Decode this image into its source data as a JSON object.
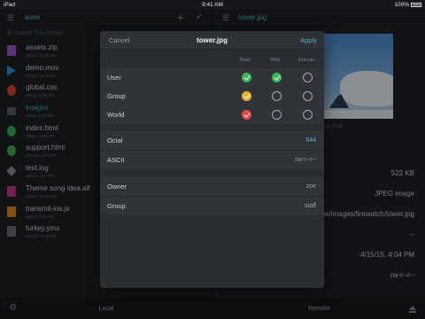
{
  "status": {
    "device": "iPad",
    "time": "9:41 AM",
    "battery": "100%"
  },
  "local": {
    "folder": "www",
    "search_placeholder": "Search This Folder",
    "files": [
      {
        "name": "assets.zip",
        "date": "8/5/14, 12:45 AM",
        "icon": "zip-icon",
        "color": "#9b59d0"
      },
      {
        "name": "demo.mov",
        "date": "8/5/14, 12:45 AM",
        "icon": "video-icon",
        "color": "#2f8fd8"
      },
      {
        "name": "global.css",
        "date": "8/5/14, 1:35 PM",
        "icon": "css-icon",
        "color": "#e0452f"
      },
      {
        "name": "images",
        "date": "Today, 1:41 PM",
        "icon": "folder-icon",
        "color": "#5a5f68",
        "selected": true
      },
      {
        "name": "index.html",
        "date": "8/5/14, 1:38 PM",
        "icon": "html-icon",
        "color": "#3db35a"
      },
      {
        "name": "support.html",
        "date": "8/10/14, 1:37 PM",
        "icon": "html-icon",
        "color": "#3db35a"
      },
      {
        "name": "test.log",
        "date": "8/5/14, 1:37 PM",
        "icon": "log-icon",
        "color": "#8d9199"
      },
      {
        "name": "Theme song idea.aif",
        "date": "8/5/14, 12:00 AM",
        "icon": "audio-icon",
        "color": "#c63a8a"
      },
      {
        "name": "transmit-ios.js",
        "date": "8/5/14, 1:24 PM",
        "icon": "js-icon",
        "color": "#e48a1f"
      },
      {
        "name": "turkey.yms",
        "date": "4/20/15, 5:55 PM",
        "icon": "file-icon",
        "color": "#6d717a"
      }
    ],
    "bottom_label": "Local"
  },
  "remote": {
    "file": "tower.jpg",
    "image_subtitle": "pe, RGB",
    "size": "522 KB",
    "kind": "JPEG image",
    "path": "/w/images/firewatch/tower.jpg",
    "dash": "--",
    "modified": "4/15/15, 4:04 PM",
    "perms": "rw-r--r--",
    "bottom_label": "Remote"
  },
  "modal": {
    "cancel": "Cancel",
    "title": "tower.jpg",
    "apply": "Apply",
    "columns": [
      "Read",
      "Write",
      "Execute"
    ],
    "rows": [
      {
        "label": "User",
        "read": true,
        "write": true,
        "execute": false,
        "color": "#3cb55b"
      },
      {
        "label": "Group",
        "read": true,
        "write": false,
        "execute": false,
        "color": "#e8b432"
      },
      {
        "label": "World",
        "read": true,
        "write": false,
        "execute": false,
        "color": "#e24a4a"
      }
    ],
    "octal_label": "Octal",
    "octal_value": "644",
    "ascii_label": "ASCII",
    "ascii_value": "rw-r--r--",
    "owner_label": "Owner",
    "owner_value": "zoe",
    "group_label": "Group",
    "group_value": "staff"
  },
  "colors": {
    "accent": "#4fb4c7",
    "background": "#1c1e22",
    "modal": "#2a2d32"
  }
}
